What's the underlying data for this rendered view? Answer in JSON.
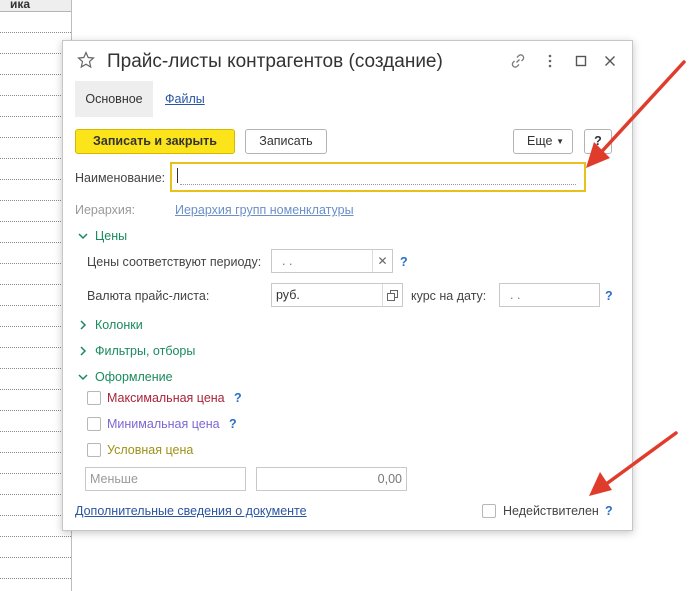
{
  "background": {
    "header_fragment": "ика"
  },
  "window": {
    "title": "Прайс-листы контрагентов (создание)",
    "icons": [
      "star-icon",
      "link-icon",
      "more-icon",
      "maximize-icon",
      "close-icon"
    ]
  },
  "tabs": {
    "main": "Основное",
    "files": "Файлы"
  },
  "toolbar": {
    "save_close": "Записать и закрыть",
    "save": "Записать",
    "more": "Еще",
    "help": "?"
  },
  "form": {
    "name_label": "Наименование:",
    "name_value": "",
    "hierarchy_label": "Иерархия:",
    "hierarchy_link": "Иерархия групп номенклатуры",
    "prices_group": "Цены",
    "period_label": "Цены соответствуют периоду:",
    "period_value": " .  .",
    "currency_label": "Валюта прайс-листа:",
    "currency_value": "руб.",
    "rate_label": "курс на дату:",
    "rate_value": " .  .",
    "columns_group": "Колонки",
    "filters_group": "Фильтры, отборы",
    "design_group": "Оформление",
    "max_price": "Максимальная цена",
    "min_price": "Минимальная цена",
    "cond_price": "Условная цена",
    "compare_placeholder": "Меньше",
    "amount_value": "0,00",
    "extra_info_link": "Дополнительные сведения о документе",
    "invalid_label": "Недействителен",
    "question_mark": "?"
  },
  "colors": {
    "accent_yellow": "#fce41b",
    "group_green": "#1a8a5e",
    "link_blue": "#2a55a3",
    "arrow_red": "#e03c2c"
  }
}
